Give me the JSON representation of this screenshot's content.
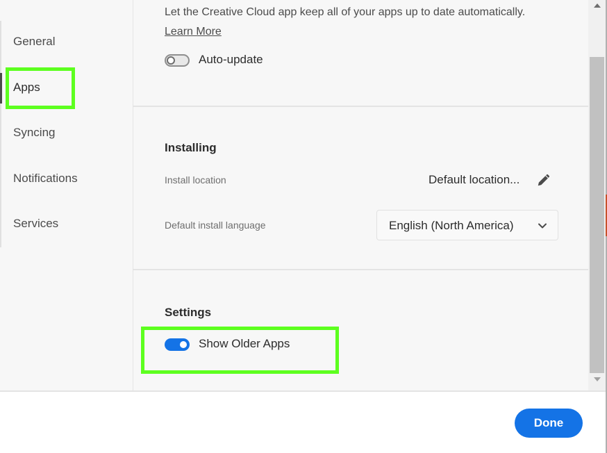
{
  "sidebar": {
    "items": [
      {
        "label": "General"
      },
      {
        "label": "Apps"
      },
      {
        "label": "Syncing"
      },
      {
        "label": "Notifications"
      },
      {
        "label": "Services"
      }
    ],
    "active": "Apps"
  },
  "auto_update": {
    "description": "Let the Creative Cloud app keep all of your apps up to date automatically.",
    "learn_more": "Learn More",
    "toggle_label": "Auto-update",
    "toggle_state": "off"
  },
  "installing": {
    "heading": "Installing",
    "install_location_label": "Install location",
    "install_location_value": "Default location...",
    "language_label": "Default install language",
    "language_value": "English (North America)"
  },
  "settings": {
    "heading": "Settings",
    "show_older_apps_label": "Show Older Apps",
    "show_older_apps_state": "on"
  },
  "footer": {
    "done_label": "Done"
  },
  "colors": {
    "accent": "#1473e6",
    "highlight": "#5dff1f",
    "panel_bg": "#f7f7f7"
  },
  "icons": [
    "pencil-icon",
    "chevron-down-icon",
    "scroll-up-arrow-icon",
    "scroll-down-arrow-icon"
  ]
}
